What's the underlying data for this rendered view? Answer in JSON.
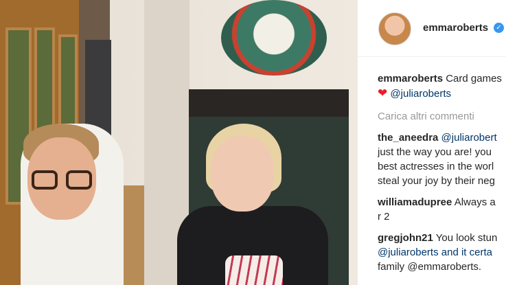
{
  "post": {
    "author": "emmaroberts",
    "caption_text": "Card games",
    "caption_heart": "❤",
    "caption_mention": "@juliaroberts"
  },
  "load_more": "Carica altri commenti",
  "comments": [
    {
      "user": "the_aneedra",
      "lines": [
        "@juliarobert",
        "just the way you are! you",
        "best actresses in the worl",
        "steal your joy by their neg"
      ]
    },
    {
      "user": "williamadupree",
      "lines": [
        "Always a",
        "r 2"
      ]
    },
    {
      "user": "gregjohn21",
      "lines": [
        "You look stun",
        "@juliaroberts and it certa",
        "family @emmaroberts."
      ]
    }
  ],
  "icons": {
    "verified": "verified-badge-icon",
    "heart": "red-heart-emoji"
  },
  "colors": {
    "link": "#003569",
    "verified": "#3897f0",
    "muted": "#999999",
    "heart": "#ed1c24"
  }
}
